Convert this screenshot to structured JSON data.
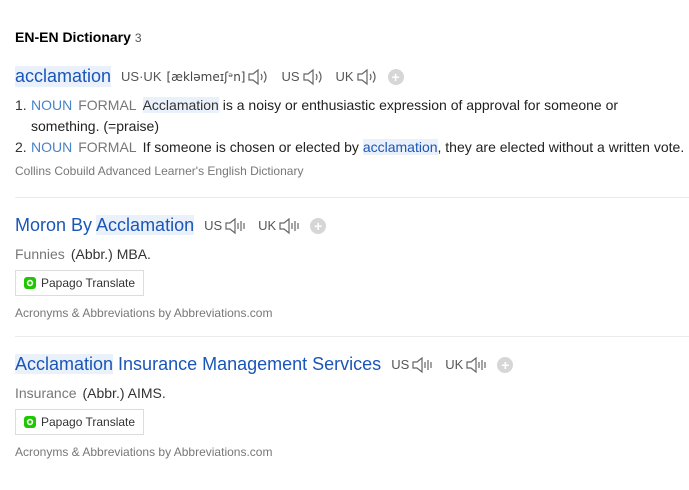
{
  "section": {
    "title": "EN-EN Dictionary",
    "count": "3"
  },
  "entry1": {
    "headword": "acclamation",
    "pron_label": "US·UK",
    "phonetic": "[ækləmeɪʃᵊn]",
    "us": "US",
    "uk": "UK",
    "senses": [
      {
        "num": "1.",
        "pos": "NOUN",
        "register": "FORMAL",
        "hl": "Acclamation",
        "text_after": " is a noisy or enthusiastic expression of approval for someone or something. (=praise)"
      },
      {
        "num": "2.",
        "pos": "NOUN",
        "register": "FORMAL",
        "text_before": "If someone is chosen or elected by ",
        "hl": "acclamation",
        "text_after": ", they are elected without a written vote."
      }
    ],
    "source": "Collins Cobuild Advanced Learner's English Dictionary"
  },
  "entry2": {
    "head_plain": "Moron By ",
    "head_hl": "Acclamation",
    "us": "US",
    "uk": "UK",
    "category": "Funnies",
    "abbr": "(Abbr.) MBA.",
    "papago": "Papago Translate",
    "source": "Acronyms & Abbreviations by Abbreviations.com"
  },
  "entry3": {
    "head_hl": "Acclamation",
    "head_plain": " Insurance Management Services",
    "us": "US",
    "uk": "UK",
    "category": "Insurance",
    "abbr": "(Abbr.) AIMS.",
    "papago": "Papago Translate",
    "source": "Acronyms & Abbreviations by Abbreviations.com"
  }
}
